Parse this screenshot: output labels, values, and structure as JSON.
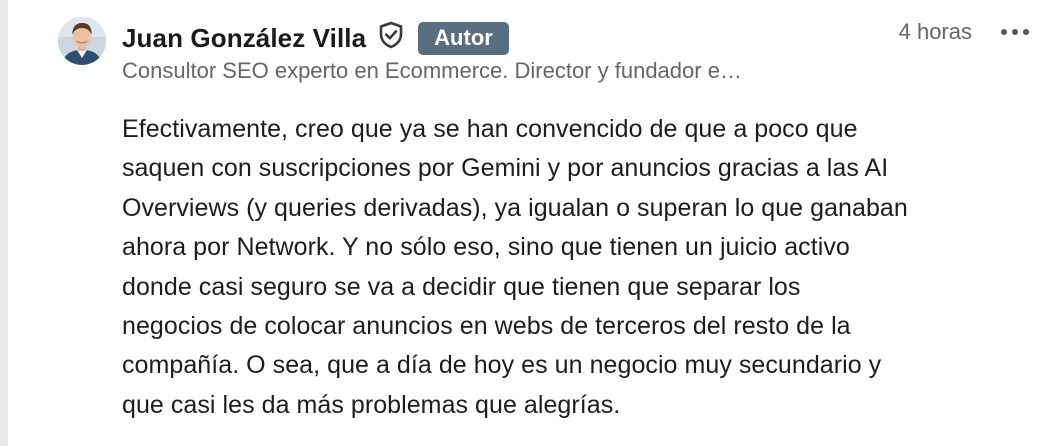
{
  "comment": {
    "author": {
      "name": "Juan González Villa",
      "badge": "Autor",
      "headline": "Consultor SEO experto en Ecommerce. Director y fundador e…",
      "verified_icon": "shield-check-icon",
      "avatar": "profile-photo"
    },
    "timestamp": "4 horas",
    "more_icon": "ellipsis-icon",
    "body_lines": [
      "Efectivamente, creo que ya se han convencido de que a poco que",
      "saquen con suscripciones por Gemini y por anuncios gracias a las AI",
      "Overviews (y queries derivadas), ya igualan o superan lo que ganaban",
      "ahora por Network. Y no sólo eso, sino que tienen un juicio activo",
      "donde casi seguro se va a decidir que tienen que separar los",
      "negocios de colocar anuncios en webs de terceros del resto de la",
      "compañía. O sea, que a día de hoy es un negocio muy secundario y",
      "que casi les da más problemas que alegrías."
    ]
  },
  "colors": {
    "badge_bg": "#5a6e82",
    "text_primary": "#1d1d1d",
    "text_secondary": "#666666",
    "thread_line": "#e9e9e6"
  }
}
